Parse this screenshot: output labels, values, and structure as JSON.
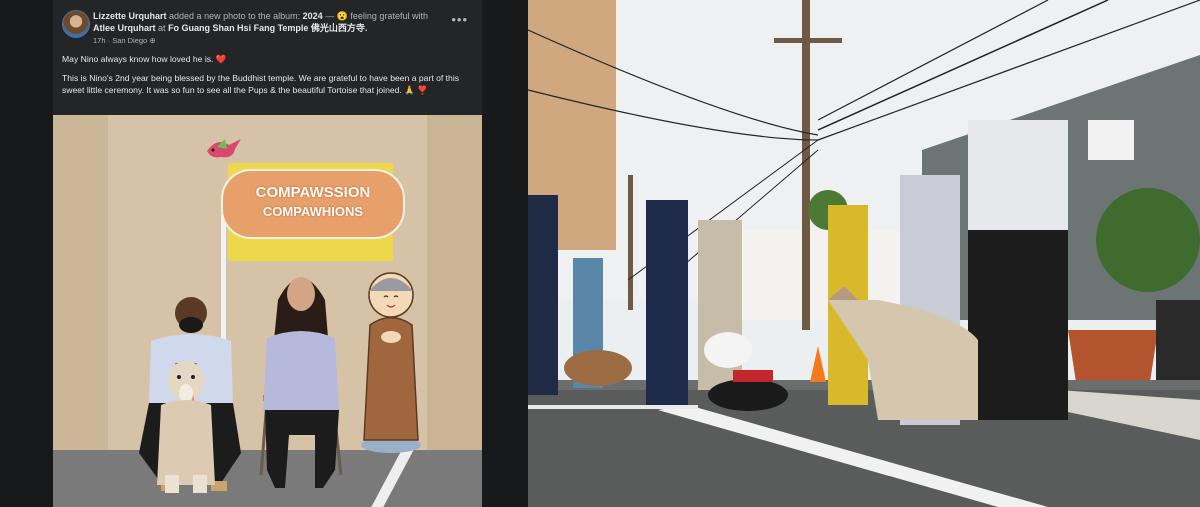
{
  "post": {
    "author": "Lizzette Urquhart",
    "action_text": "added a new photo to the album:",
    "album": "2024",
    "feeling": "— 😮 feeling grateful with",
    "tagged": "Atlee Urquhart",
    "at_text": "at",
    "location": "Fo Guang Shan Hsi Fang Temple 佛光山西方寺.",
    "time": "17h",
    "place": "San Diego",
    "more_label": "•••",
    "caption_line1": "May Nino always know how loved he is. ❤️",
    "caption_line2": "This is Nino's 2nd year being blessed by the  Buddhist temple. We are grateful to have been a part of this sweet little ceremony. It was so fun to see all the Pups & the beautiful Tortoise that joined. 🙏 ❣️"
  },
  "photo_sign": {
    "line1": "COMPAWSSION",
    "line2": "COMPAWHIONS"
  },
  "colors": {
    "bg": "#18191a",
    "card": "#242526",
    "text_primary": "#e4e6eb",
    "text_secondary": "#b0b3b8",
    "sign_yellow": "#ecd84a",
    "sign_bone": "#e8a06a"
  }
}
